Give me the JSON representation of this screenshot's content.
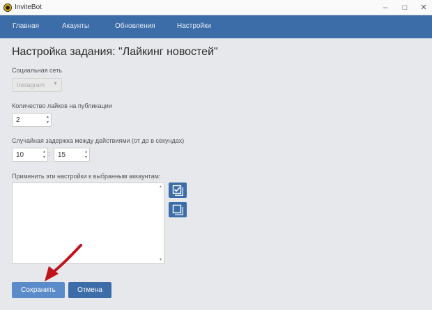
{
  "window": {
    "title": "InviteBot",
    "minimize_icon": "–",
    "maximize_icon": "□",
    "close_icon": "✕"
  },
  "nav": {
    "items": [
      "Главная",
      "Акаунты",
      "Обновления",
      "Настройки"
    ]
  },
  "page": {
    "title": "Настройка задания: \"Лайкинг новостей\""
  },
  "form": {
    "social_label": "Социальная сеть",
    "social_value": "Instagram",
    "likes_label": "Количество лайков на публикации",
    "likes_value": "2",
    "delay_label": "Случайная задержка между действиями (от до в секундах)",
    "delay_from": "10",
    "delay_to": "15",
    "delay_separator": ":",
    "accounts_label": "Применить эти настройки к выбранным аккаунтам:",
    "accounts": []
  },
  "buttons": {
    "save": "Сохранить",
    "cancel": "Отмена"
  },
  "colors": {
    "accent": "#3c6da8",
    "annotation_arrow": "#c0141c"
  }
}
